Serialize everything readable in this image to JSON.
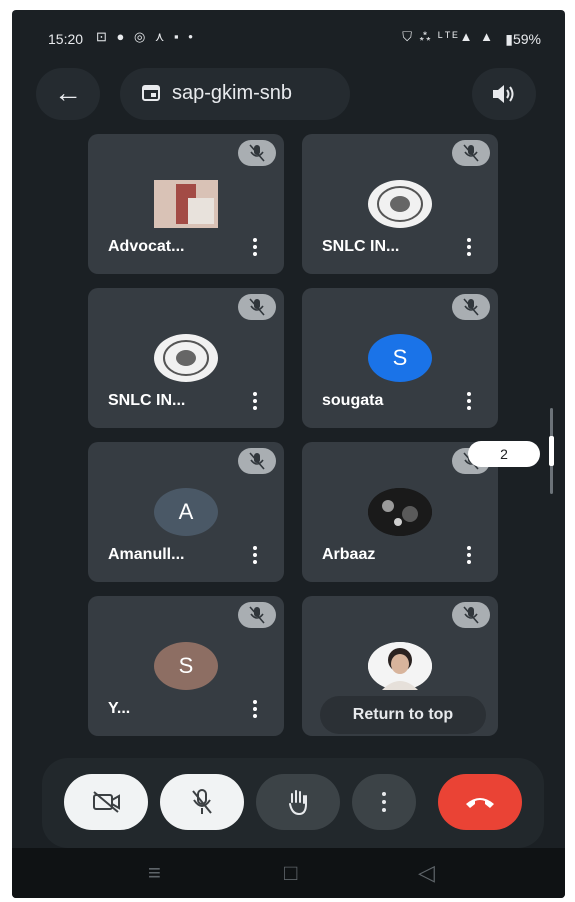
{
  "status": {
    "time": "15:20",
    "left_icons": "⊡ ● ◎ ⋏ ▪ •",
    "right_icons": "⛉ ⁂ ᴸᵀᴱ▲ ▲",
    "battery": "▮59%"
  },
  "topbar": {
    "back_icon": "←",
    "meeting_code": "sap-gkim-snb"
  },
  "tiles": [
    {
      "name": "Advocat...",
      "avatar_type": "photo",
      "avatar_letter": ""
    },
    {
      "name": "SNLC IN...",
      "avatar_type": "logo",
      "avatar_letter": ""
    },
    {
      "name": "SNLC IN...",
      "avatar_type": "logo",
      "avatar_letter": ""
    },
    {
      "name": "sougata",
      "avatar_type": "letter",
      "avatar_letter": "S",
      "avatar_color": "#1a73e8"
    },
    {
      "name": "Amanull...",
      "avatar_type": "letter",
      "avatar_letter": "A",
      "avatar_color": "#4a5866"
    },
    {
      "name": "Arbaaz",
      "avatar_type": "photo",
      "avatar_letter": ""
    },
    {
      "name": "Y...",
      "avatar_type": "letter",
      "avatar_letter": "S",
      "avatar_color": "#8d6e63"
    },
    {
      "name": "",
      "avatar_type": "photo",
      "avatar_letter": ""
    }
  ],
  "page_indicator": "2",
  "return_to_top": "Return to top",
  "colors": {
    "end_call": "#ea4335",
    "control_white": "#f1f3f4",
    "control_dark": "#3c4347"
  },
  "nav": {
    "recents": "≡",
    "home": "□",
    "back": "◁"
  }
}
